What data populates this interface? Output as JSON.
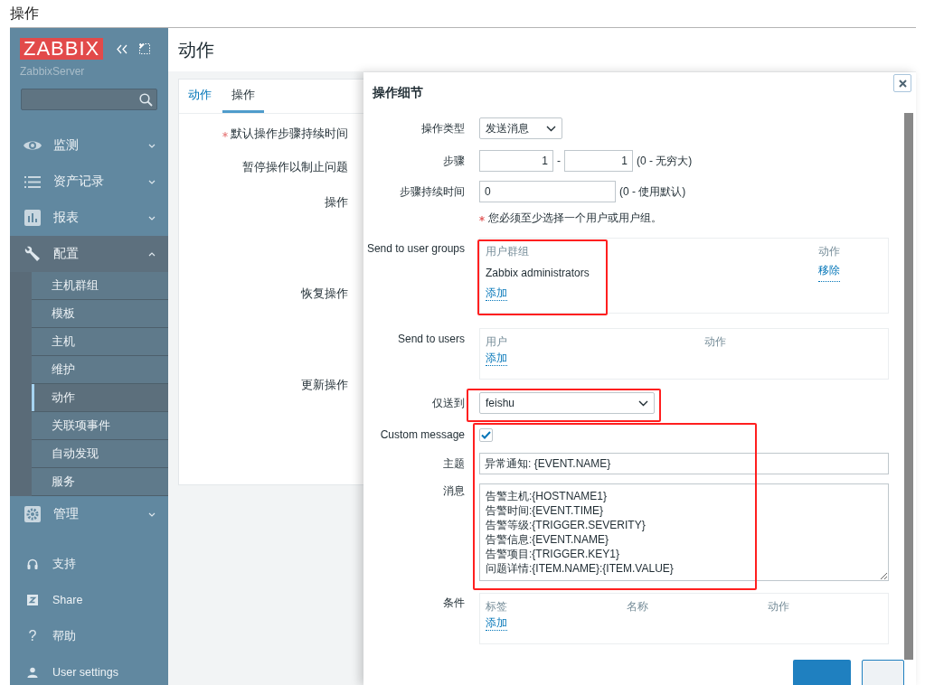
{
  "window": {
    "title": "操作"
  },
  "sidebar": {
    "logo": "ZABBIX",
    "server": "ZabbixServer",
    "menu": [
      {
        "label": "监测",
        "expanded": false
      },
      {
        "label": "资产记录",
        "expanded": false
      },
      {
        "label": "报表",
        "expanded": false
      },
      {
        "label": "配置",
        "expanded": true,
        "children": [
          {
            "label": "主机群组",
            "selected": false
          },
          {
            "label": "模板",
            "selected": false
          },
          {
            "label": "主机",
            "selected": false
          },
          {
            "label": "维护",
            "selected": false
          },
          {
            "label": "动作",
            "selected": true
          },
          {
            "label": "关联项事件",
            "selected": false
          },
          {
            "label": "自动发现",
            "selected": false
          },
          {
            "label": "服务",
            "selected": false
          }
        ]
      },
      {
        "label": "管理",
        "expanded": false
      }
    ],
    "footer": [
      {
        "label": "支持",
        "kind": "svg"
      },
      {
        "label": "Share",
        "kind": "svg"
      },
      {
        "label": "帮助",
        "kind": "char",
        "icon_char": "?"
      },
      {
        "label": "User settings",
        "kind": "svg"
      }
    ]
  },
  "header": {
    "title": "动作"
  },
  "tabs": [
    {
      "label": "动作",
      "selected": false
    },
    {
      "label": "操作",
      "selected": true
    }
  ],
  "form": {
    "fields": [
      {
        "label": "默认操作步骤持续时间",
        "required": true
      },
      {
        "label": "暂停操作以制止问题",
        "required": false
      },
      {
        "label": "操作",
        "required": false
      },
      {
        "label": "恢复操作",
        "required": false
      },
      {
        "label": "更新操作",
        "required": false
      }
    ]
  },
  "dialog": {
    "title": "操作细节",
    "operation_type": {
      "label": "操作类型",
      "value": "发送消息"
    },
    "steps": {
      "label": "步骤",
      "from": "1",
      "separator": "-",
      "to": "1",
      "hint": "(0 - 无穷大)"
    },
    "step_duration": {
      "label": "步骤持续时间",
      "value": "0",
      "hint": "(0 - 使用默认)"
    },
    "note": {
      "text": "您必须至少选择一个用户或用户组。",
      "required": true
    },
    "user_groups": {
      "label": "Send to user groups",
      "columns": [
        "用户群组",
        "动作"
      ],
      "rows": [
        {
          "name": "Zabbix administrators",
          "action": "移除"
        }
      ],
      "add": "添加"
    },
    "users": {
      "label": "Send to users",
      "columns": [
        "用户",
        "动作"
      ],
      "add": "添加"
    },
    "send_only_to": {
      "label": "仅送到",
      "value": "feishu"
    },
    "custom_message": {
      "label": "Custom message",
      "checked": true
    },
    "subject": {
      "label": "主题",
      "value": "异常通知: {EVENT.NAME}"
    },
    "message": {
      "label": "消息",
      "lines": [
        "告警主机:{HOSTNAME1}",
        "告警时间:{EVENT.TIME}",
        "告警等级:{TRIGGER.SEVERITY}",
        "告警信息:{EVENT.NAME}",
        "告警项目:{TRIGGER.KEY1}",
        "问题详情:{ITEM.NAME}:{ITEM.VALUE}"
      ]
    },
    "conditions": {
      "label": "条件",
      "columns": [
        "标签",
        "名称",
        "动作"
      ],
      "add": "添加"
    }
  }
}
